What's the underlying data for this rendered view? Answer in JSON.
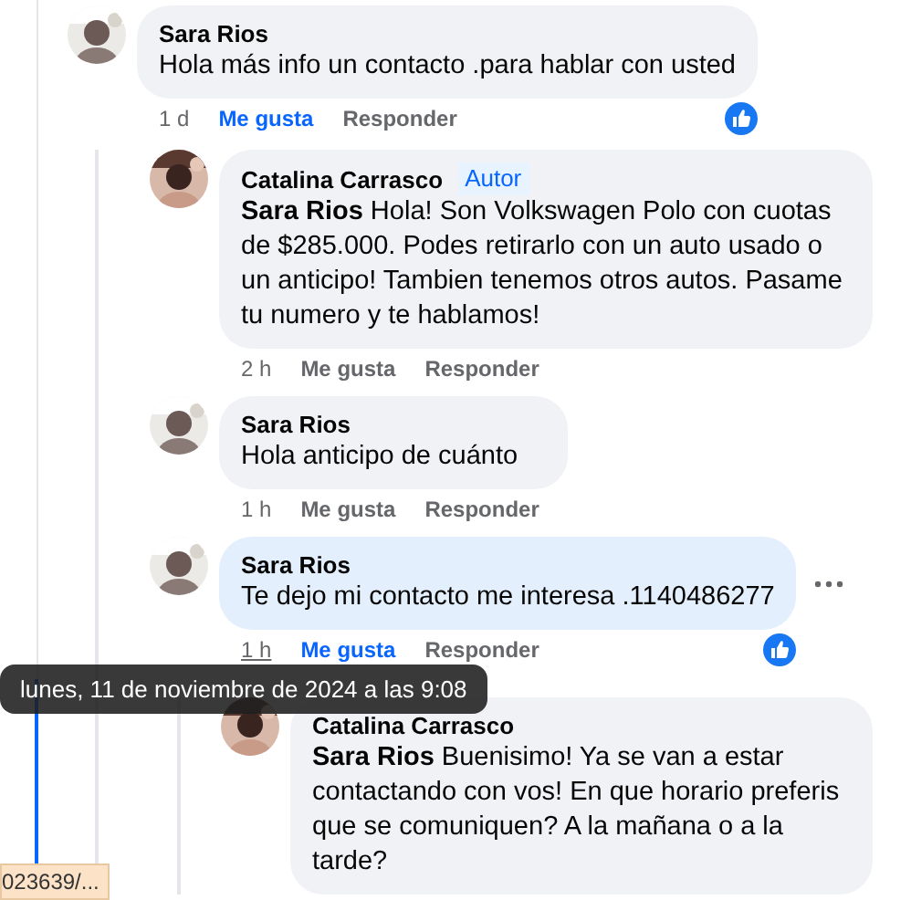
{
  "comments": [
    {
      "author": "Sara Rios",
      "text": "Hola más info un contacto .para hablar con usted",
      "time": "1 d",
      "like": "Me gusta",
      "reply": "Responder",
      "liked": true,
      "children": [
        {
          "author": "Catalina Carrasco",
          "badge": "Autor",
          "text": "**Sara Rios** Hola! Son Volkswagen Polo con cuotas de $285.000. Podes retirarlo con un auto usado o un anticipo! Tambien tenemos otros autos. Pasame tu numero y te hablamos!",
          "time": "2 h",
          "like": "Me gusta",
          "reply": "Responder",
          "liked": false
        },
        {
          "author": "Sara Rios",
          "text": "Hola anticipo de cuánto",
          "time": "1 h",
          "like": "Me gusta",
          "reply": "Responder",
          "liked": false
        },
        {
          "author": "Sara Rios",
          "text": "Te dejo mi contacto me interesa .1140486277",
          "time": "1 h",
          "like": "Me gusta",
          "reply": "Responder",
          "liked": true,
          "highlighted": true,
          "time_hovered": true,
          "more_menu": true,
          "children": [
            {
              "author": "Catalina Carrasco",
              "text": "**Sara Rios** Buenisimo! Ya se van a estar contactando con vos! En que horario preferis que se comuniquen? A la mañana o a la tarde?"
            }
          ]
        }
      ]
    }
  ],
  "tooltip": "lunes, 11 de noviembre de 2024 a las 9:08",
  "status_link": "023639/..."
}
